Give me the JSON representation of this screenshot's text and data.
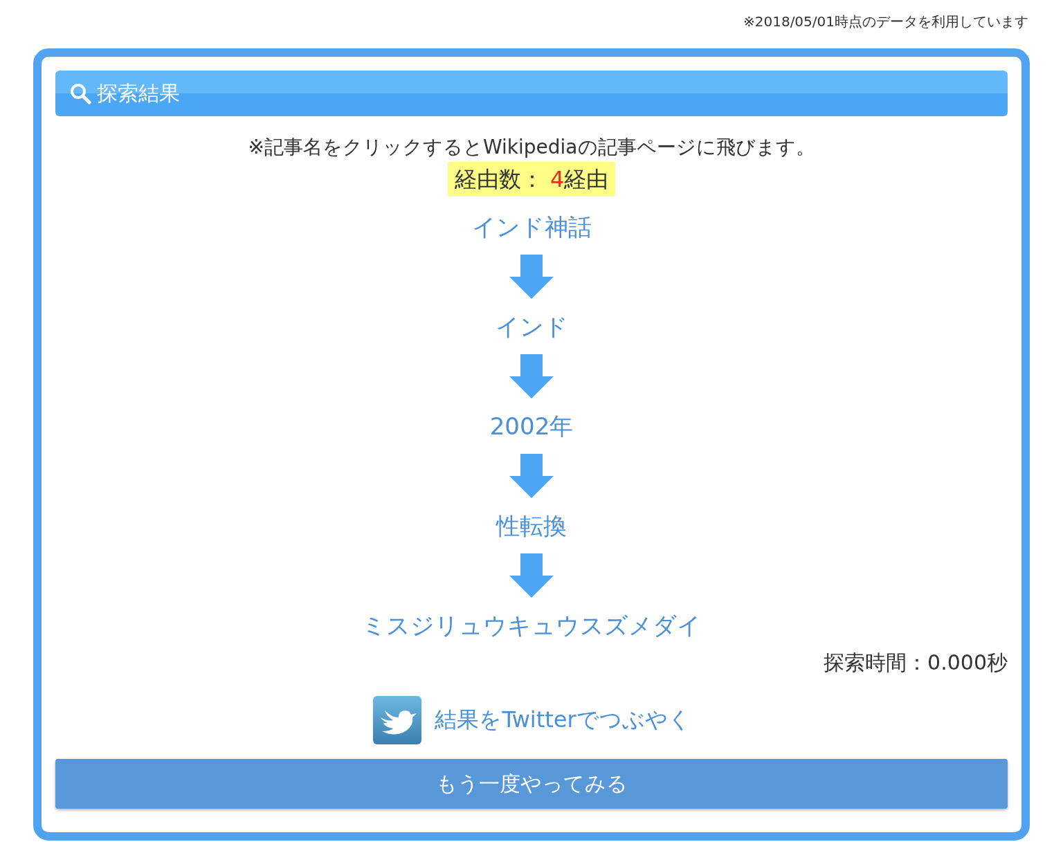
{
  "data_note": "※2018/05/01時点のデータを利用しています",
  "header": {
    "title": "探索結果"
  },
  "instruction": "※記事名をクリックするとWikipediaの記事ページに飛びます。",
  "hops": {
    "label": "経由数：",
    "value": "4",
    "unit": "経由"
  },
  "path": [
    "インド神話",
    "インド",
    "2002年",
    "性転換",
    "ミスジリュウキュウスズメダイ"
  ],
  "search_time": "探索時間：0.000秒",
  "share_link": "結果をTwitterでつぶやく",
  "retry_button": "もう一度やってみる"
}
